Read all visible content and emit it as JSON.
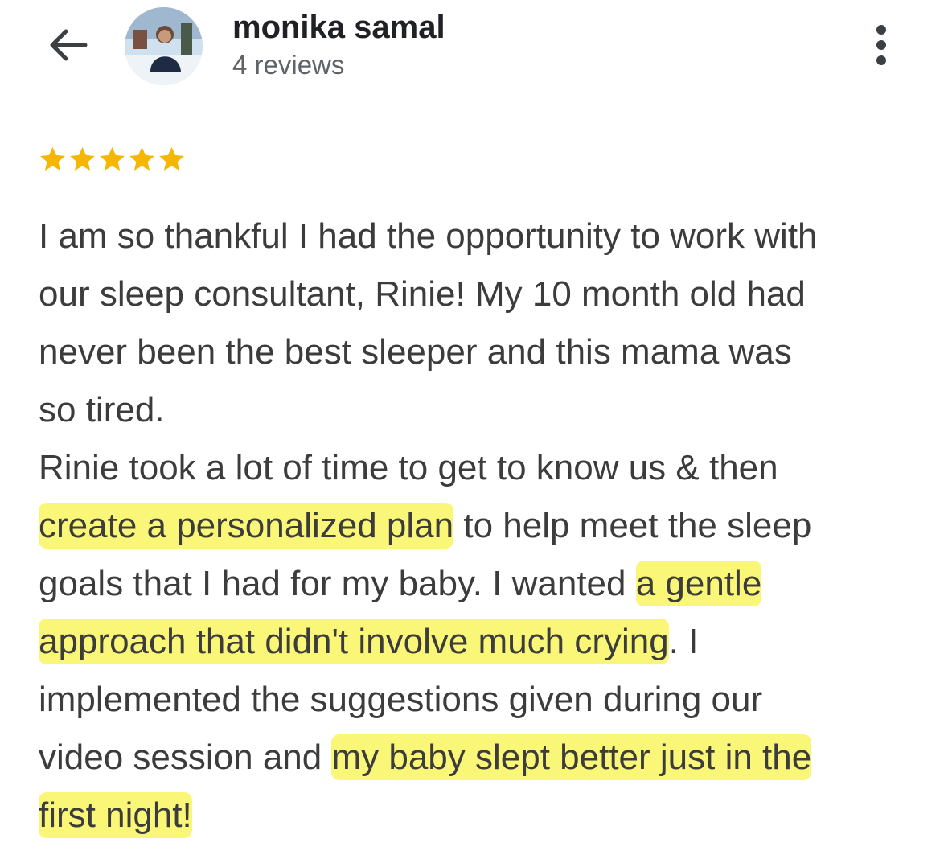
{
  "header": {
    "back_icon": "arrow-back-icon",
    "reviewer_name": "monika samal",
    "review_count": "4 reviews",
    "more_icon": "more-vert-icon"
  },
  "review": {
    "rating": 5,
    "star_color": "#f6b703",
    "highlight_color": "#faf678",
    "lines": [
      [
        {
          "t": "I am so thankful I had the opportunity to work with",
          "hl": false
        }
      ],
      [
        {
          "t": "our sleep consultant, Rinie! My 10 month old had",
          "hl": false
        }
      ],
      [
        {
          "t": "never been the best sleeper and this mama was",
          "hl": false
        }
      ],
      [
        {
          "t": "so tired.",
          "hl": false
        }
      ],
      [
        {
          "t": "Rinie took a lot of time to get to know us & then",
          "hl": false
        }
      ],
      [
        {
          "t": "create a personalized plan",
          "hl": true
        },
        {
          "t": " to help meet the sleep",
          "hl": false
        }
      ],
      [
        {
          "t": "goals that I had for my baby. I wanted ",
          "hl": false
        },
        {
          "t": "a gentle",
          "hl": true
        }
      ],
      [
        {
          "t": "approach that didn't involve much crying",
          "hl": true
        },
        {
          "t": ". I",
          "hl": false
        }
      ],
      [
        {
          "t": "implemented the suggestions given during our",
          "hl": false
        }
      ],
      [
        {
          "t": "video session and ",
          "hl": false
        },
        {
          "t": "my baby slept better just in the",
          "hl": true
        }
      ],
      [
        {
          "t": "first night!",
          "hl": true
        }
      ]
    ]
  }
}
